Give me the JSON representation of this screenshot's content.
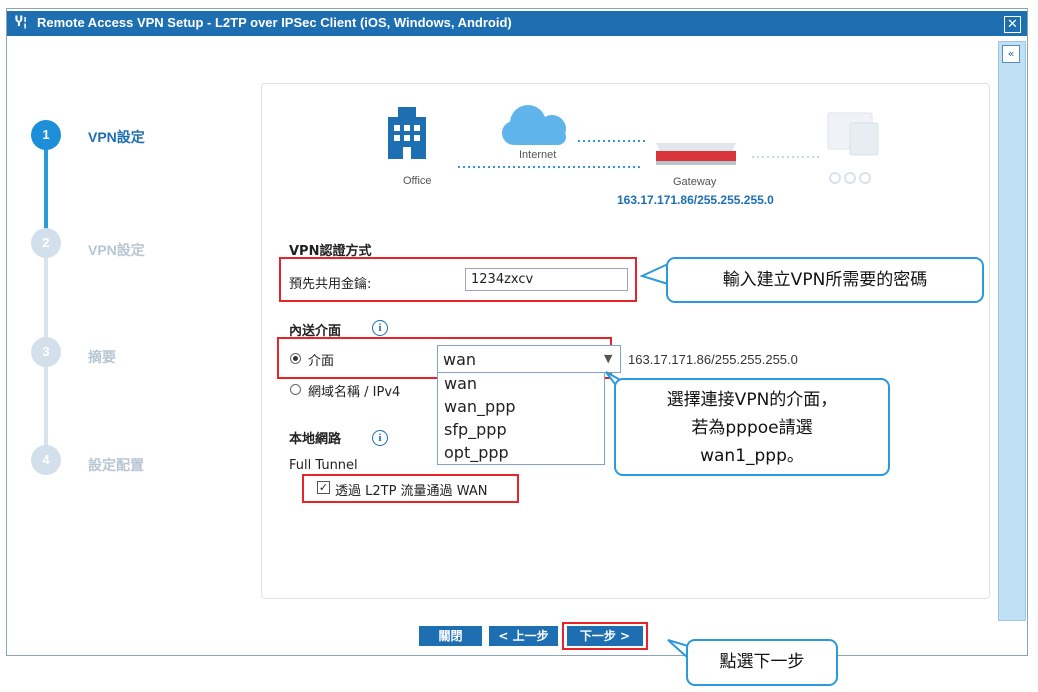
{
  "window": {
    "title": "Remote Access VPN Setup - L2TP over IPSec Client (iOS, Windows, Android)",
    "title_icon": "tools-icon",
    "close_label": "✕",
    "collapse_label": "«"
  },
  "steps": [
    {
      "number": "1",
      "label": "VPN設定",
      "state": "active"
    },
    {
      "number": "2",
      "label": "VPN設定",
      "state": "inactive"
    },
    {
      "number": "3",
      "label": "摘要",
      "state": "inactive"
    },
    {
      "number": "4",
      "label": "設定配置",
      "state": "inactive"
    }
  ],
  "diagram": {
    "office_label": "Office",
    "internet_label": "Internet",
    "gateway_label": "Gateway",
    "gateway_ip": "163.17.171.86/255.255.255.0"
  },
  "form": {
    "auth_heading": "VPN認證方式",
    "psk_label": "預先共用金鑰:",
    "psk_value": "1234zxcv",
    "outgoing_heading": "內送介面",
    "interface_radio_label": "介面",
    "interface_value": "wan",
    "interface_ip": "163.17.171.86/255.255.255.0",
    "interface_options": [
      "wan",
      "wan_ppp",
      "sfp_ppp",
      "opt_ppp"
    ],
    "domain_radio_label": "網域名稱 / IPv4",
    "local_heading": "本地網路",
    "full_tunnel_label": "Full Tunnel",
    "l2tp_checkbox_label": "透過 L2TP 流量通過 WAN",
    "l2tp_checked": true
  },
  "buttons": {
    "close": "關閉",
    "back": "< 上一步",
    "next": "下一步 >"
  },
  "callouts": {
    "psk_note": "輸入建立VPN所需要的密碼",
    "interface_note_line1": "選擇連接VPN的介面，",
    "interface_note_line2": "若為pppoe請選",
    "interface_note_line3": "wan1_ppp。",
    "next_note": "點選下一步"
  },
  "colors": {
    "title_bar": "#1d6fb1",
    "active_step": "#1d8fd8",
    "inactive_step": "#d3dfea",
    "highlight_red": "#e8242a",
    "callout_border": "#2a9bd8",
    "ip_text": "#1d6fb1"
  }
}
